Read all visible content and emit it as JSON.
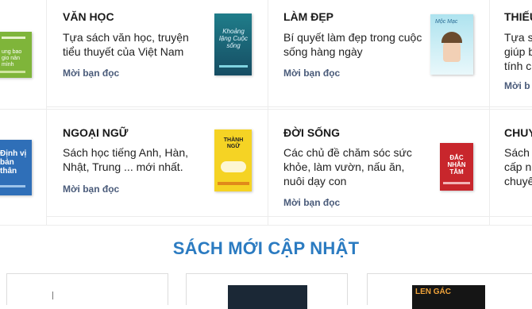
{
  "categories": [
    {
      "title": "VĂN HỌC",
      "desc": "Tựa sách văn học, truyện tiểu thuyết của Việt Nam",
      "link": "Mời bạn đọc",
      "cover_text": "Khoảng lặng Cuộc sống"
    },
    {
      "title": "LÀM ĐẸP",
      "desc": "Bí quyết làm đẹp trong cuộc sống hàng ngày",
      "link": "Mời bạn đọc",
      "cover_text": "Mộc Mạc"
    },
    {
      "title": "THIẾU",
      "desc": "Tựa s giúp b tính c",
      "link": "Mời b"
    },
    {
      "title": "NGOẠI NGỮ",
      "desc": "Sách học tiếng Anh, Hàn, Nhật, Trung ... mới nhất.",
      "link": "Mời bạn đọc",
      "cover_text": "THÀNH NGỮ"
    },
    {
      "title": "ĐỜI SỐNG",
      "desc": "Các chủ đề chăm sóc sức khỏe, làm vườn, nấu ăn, nuôi dạy con",
      "link": "Mời bạn đọc",
      "cover_text": "ĐẮC NHÂN TÂM"
    },
    {
      "title": "CHUY",
      "desc": "Sách cấp n chuyê",
      "link": ""
    }
  ],
  "left_covers": [
    "ung bao gio nản mình",
    "Định vị bản thân"
  ],
  "section": {
    "title": "SÁCH MỚI CẬP NHẬT"
  },
  "products": [
    {
      "cover_text": ""
    },
    {
      "cover_text": ""
    },
    {
      "cover_text": "LEN GÁC"
    }
  ],
  "colors": {
    "accent": "#2b7bc1",
    "link": "#4a5b7a",
    "border": "#ececec"
  }
}
